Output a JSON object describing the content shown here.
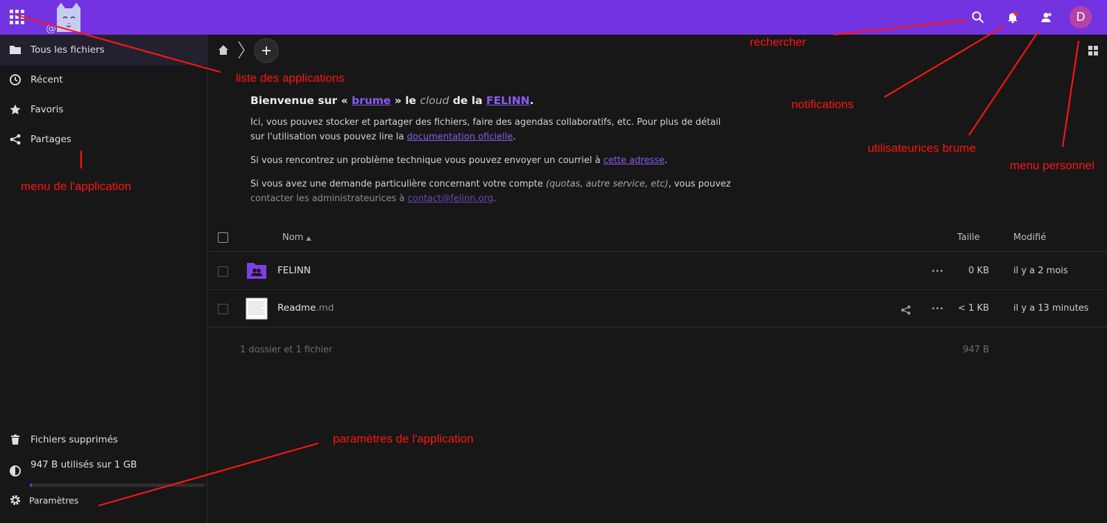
{
  "header": {
    "brand_color": "#7433e0",
    "apps_icon": "grid-icon",
    "logo_icon": "cat-logo-icon",
    "search_icon": "search-icon",
    "notifications_icon": "bell-icon",
    "contacts_icon": "contacts-icon",
    "avatar_letter": "D"
  },
  "sidebar": {
    "items": [
      {
        "label": "Tous les fichiers",
        "icon": "folder-icon"
      },
      {
        "label": "Récent",
        "icon": "clock-icon"
      },
      {
        "label": "Favoris",
        "icon": "star-icon"
      },
      {
        "label": "Partages",
        "icon": "share-icon"
      }
    ],
    "deleted_label": "Fichiers supprimés",
    "quota_label": "947 B utilisés sur 1 GB",
    "quota_fraction": 0.01,
    "settings_label": "Paramètres"
  },
  "main": {
    "welcome": {
      "title_prefix": "Bienvenue sur « ",
      "title_brume": "brume",
      "title_mid": " » le ",
      "title_cloud": "cloud",
      "title_suffix": " de la ",
      "title_felinn": "FELINN",
      "title_end": ".",
      "p1_text": "Ici, vous pouvez stocker et partager des fichiers, faire des agendas collaboratifs, etc. Pour plus de détail sur l'utilisation vous pouvez lire la ",
      "p1_link": "documentation oficielle",
      "p1_end": ".",
      "p2_text": "Si vous rencontrez un problème technique vous pouvez envoyer un courriel à ",
      "p2_link": "cette adresse",
      "p2_end": ".",
      "p3_text": "Si vous avez une demande particulière concernant votre compte ",
      "p3_em": "(quotas, autre service, etc)",
      "p3_mid": ", vous pouvez ",
      "p3_fade": "contacter les administrateurices à ",
      "p3_link": "contact@felinn.org",
      "p3_end": "."
    },
    "table": {
      "col_name": "Nom",
      "col_size": "Taille",
      "col_modified": "Modifié",
      "rows": [
        {
          "name": "FELINN",
          "ext": "",
          "size": "0 KB",
          "modified": "il y a 2 mois",
          "icon": "group-folder-icon"
        },
        {
          "name": "Readme",
          "ext": ".md",
          "size": "< 1 KB",
          "modified": "il y a 13 minutes",
          "icon": "text-file-icon"
        }
      ],
      "summary_text": "1 dossier et 1 fichier",
      "summary_size": "947 B"
    }
  },
  "annotations": {
    "color": "#ff1414",
    "apps_list": "liste des applications",
    "search": "rechercher",
    "notifications": "notifications",
    "users": "utilisateurices brume",
    "personal_menu": "menu personnel",
    "app_menu": "menu de l'application",
    "app_settings": "paramètres de l'application"
  }
}
